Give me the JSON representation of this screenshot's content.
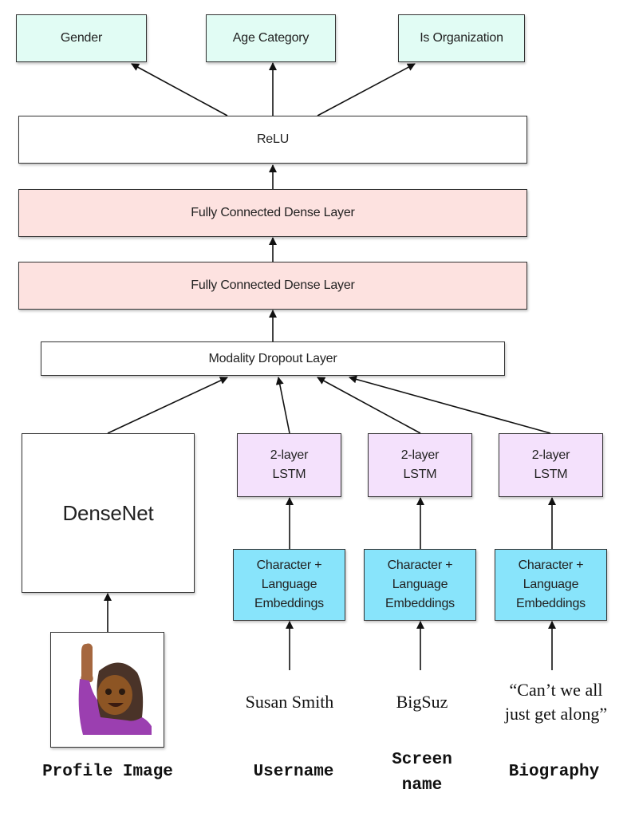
{
  "outputs": [
    "Gender",
    "Age Category",
    "Is Organization"
  ],
  "relu": "ReLU",
  "dense_layers": [
    "Fully Connected Dense Layer",
    "Fully Connected Dense Layer"
  ],
  "dropout": "Modality Dropout Layer",
  "densenet": "DenseNet",
  "lstm": [
    [
      "2-layer",
      "LSTM"
    ],
    [
      "2-layer",
      "LSTM"
    ],
    [
      "2-layer",
      "LSTM"
    ]
  ],
  "embeddings": [
    [
      "Character +",
      "Language",
      "Embeddings"
    ],
    [
      "Character +",
      "Language",
      "Embeddings"
    ],
    [
      "Character +",
      "Language",
      "Embeddings"
    ]
  ],
  "examples": {
    "username": "Susan Smith",
    "screen_name": "BigSuz",
    "biography": [
      "“Can’t we all",
      "just get along”"
    ]
  },
  "profile_image_icon": "woman-raising-hand-emoji",
  "input_labels": {
    "profile_image": "Profile Image",
    "username": "Username",
    "screen_name": [
      "Screen",
      "name"
    ],
    "biography": "Biography"
  },
  "colors": {
    "output": "#e1fcf4",
    "dense": "#fde2e0",
    "lstm": "#f4e1fc",
    "embedding": "#88e4fb"
  }
}
